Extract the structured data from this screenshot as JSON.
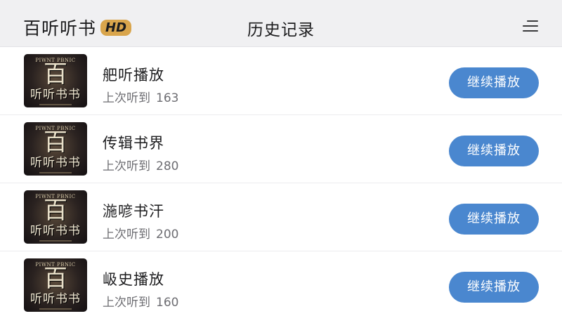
{
  "header": {
    "app_name": "百听听书",
    "hd_badge": "HD",
    "page_title": "历史记录",
    "menu_icon": "menu-icon"
  },
  "cover": {
    "top_text": "PIWNT PBNIC",
    "big_char": "百",
    "sub_text": "听听书书"
  },
  "history": {
    "progress_label": "上次听到",
    "resume_label": "继续播放",
    "items": [
      {
        "title": "舥听播放",
        "last_position": "163"
      },
      {
        "title": "传辑书界",
        "last_position": "280"
      },
      {
        "title": "湤喭书汗",
        "last_position": "200"
      },
      {
        "title": "岋史播放",
        "last_position": "160"
      }
    ]
  },
  "colors": {
    "button": "#4a87cf",
    "header_bg": "#f0f0f2",
    "badge": "#d9a54c"
  }
}
